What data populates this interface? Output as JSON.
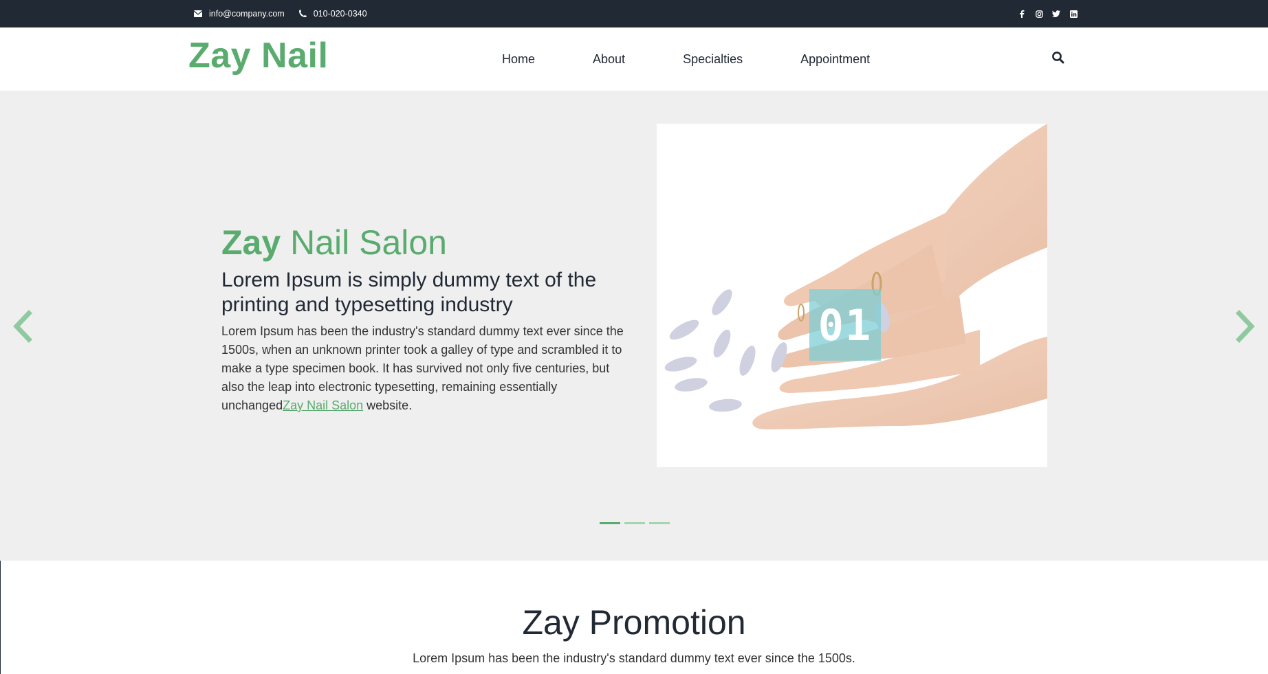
{
  "topbar": {
    "email": "info@company.com",
    "phone": "010-020-0340",
    "social": [
      "facebook-icon",
      "instagram-icon",
      "twitter-icon",
      "linkedin-icon"
    ]
  },
  "brand": {
    "name": "Zay Nail",
    "color": "#59ab6e"
  },
  "nav": {
    "items": [
      {
        "label": "Home"
      },
      {
        "label": "About"
      },
      {
        "label": "Specialties"
      },
      {
        "label": "Appointment"
      }
    ],
    "search_icon": "search-icon"
  },
  "hero": {
    "title_bold": "Zay",
    "title_light": " Nail Salon",
    "subtitle": "Lorem Ipsum is simply dummy text of the printing and typesetting industry",
    "body": "Lorem Ipsum has been the industry's standard dummy text ever since the 1500s, when an unknown printer took a galley of type and scrambled it to make a type specimen book. It has survived not only five centuries, but also the leap into electronic typesetting, remaining essentially unchanged",
    "link": "Zay Nail Salon",
    "body_end": " website.",
    "badge": "01",
    "slides": 3,
    "active_slide": 0
  },
  "promotion": {
    "title": "Zay Promotion",
    "text": "Lorem Ipsum has been the industry's standard dummy text ever since the 1500s."
  },
  "colors": {
    "accent": "#59ab6e",
    "dark": "#212934",
    "hero_bg": "#efefef"
  }
}
